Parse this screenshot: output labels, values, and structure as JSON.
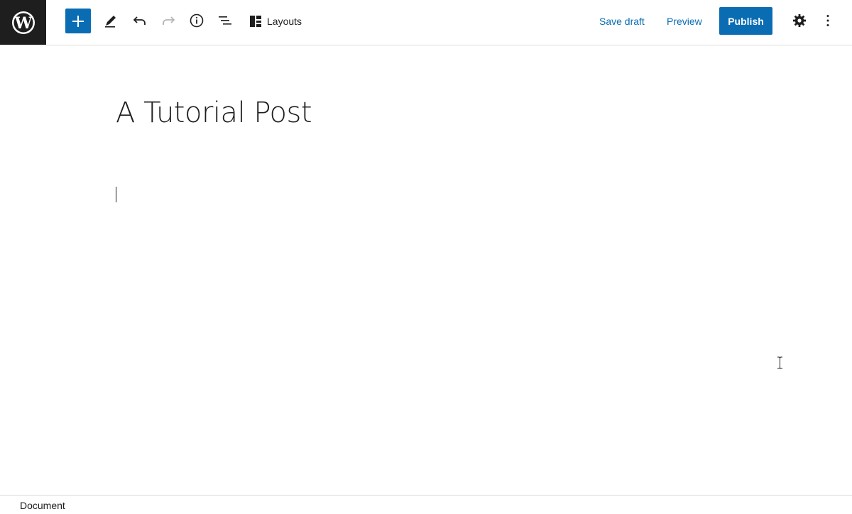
{
  "toolbar": {
    "layouts_label": "Layouts",
    "save_draft_label": "Save draft",
    "preview_label": "Preview",
    "publish_label": "Publish"
  },
  "post": {
    "title": "A Tutorial Post"
  },
  "footer": {
    "breadcrumb": "Document"
  },
  "colors": {
    "accent": "#0a6db3",
    "logo_bg": "#1e1e1e"
  },
  "icons": {
    "logo": "wordpress-logo-icon",
    "inserter": "plus-icon",
    "tools": "pencil-icon",
    "undo": "undo-icon",
    "redo": "redo-icon",
    "details": "info-icon",
    "outline": "list-view-icon",
    "layouts": "layouts-icon",
    "settings": "gear-icon",
    "options": "more-vertical-icon"
  }
}
